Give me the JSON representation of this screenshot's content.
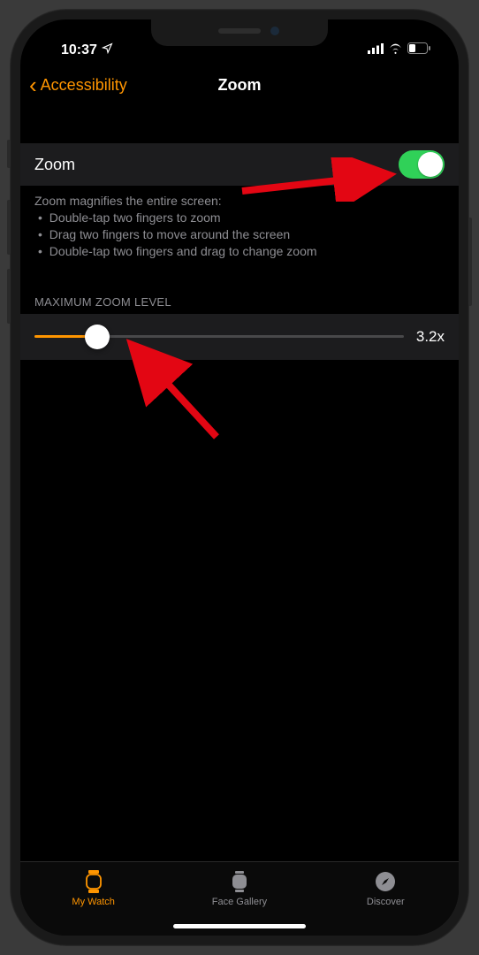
{
  "status": {
    "time": "10:37"
  },
  "nav": {
    "back_label": "Accessibility",
    "title": "Zoom"
  },
  "settings": {
    "zoom_label": "Zoom",
    "zoom_on": true,
    "description_intro": "Zoom magnifies the entire screen:",
    "description_items": [
      "Double-tap two fingers to zoom",
      "Drag two fingers to move around the screen",
      "Double-tap two fingers and drag to change zoom"
    ]
  },
  "slider": {
    "header": "MAXIMUM ZOOM LEVEL",
    "value_label": "3.2x"
  },
  "tabs": {
    "my_watch": "My Watch",
    "face_gallery": "Face Gallery",
    "discover": "Discover"
  }
}
